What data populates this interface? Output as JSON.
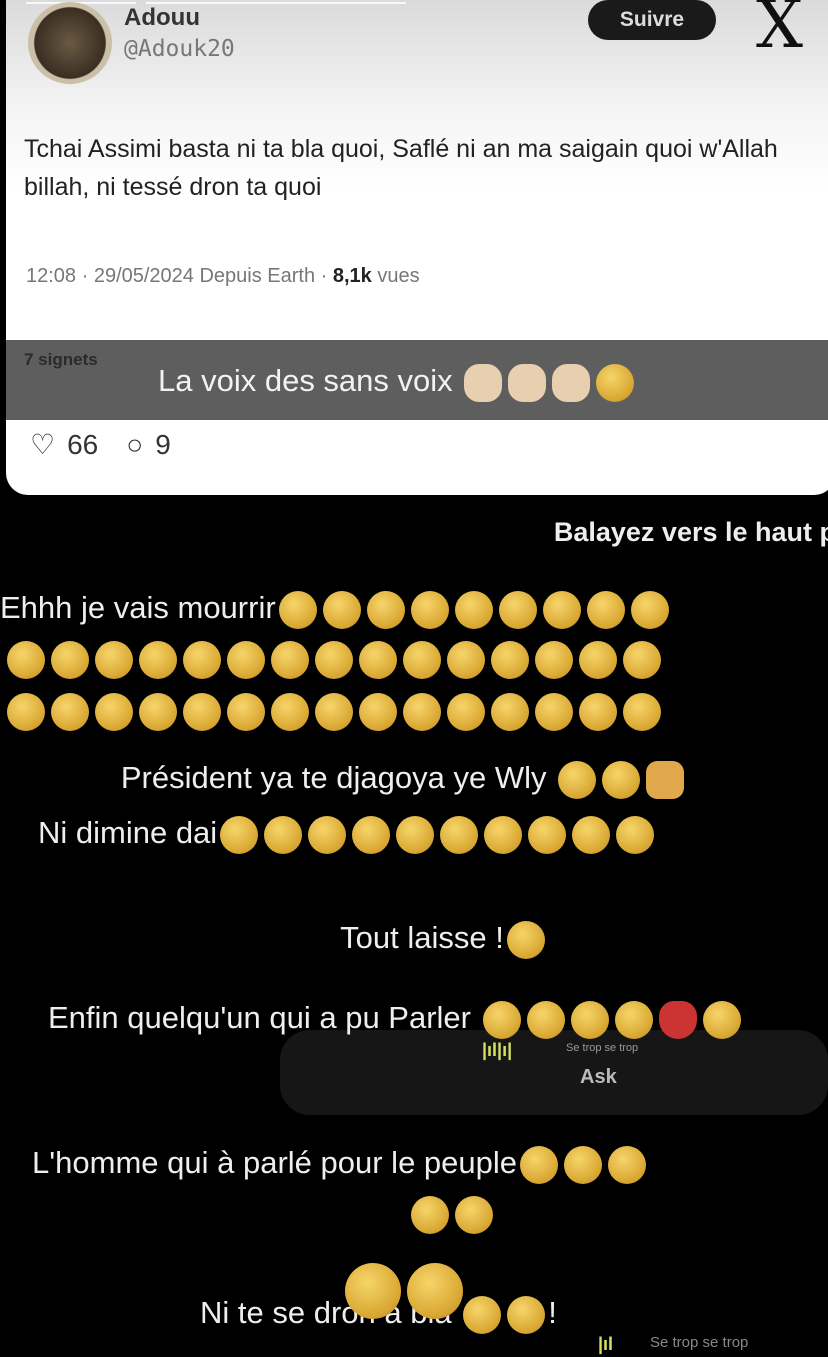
{
  "tweet": {
    "name": "Adouu",
    "handle": "@Adouk20",
    "follow_label": "Suivre",
    "logo": "X",
    "text": "Tchai Assimi basta ni ta bla quoi, Saflé ni an ma saigain quoi w'Allah billah, ni tessé dron ta quoi",
    "time": "12:08 · 29/05/2024 Depuis Earth · ",
    "views_count": "8,1k",
    "views_label": " vues",
    "bookmarks": "7 signets",
    "likes": "66",
    "replies": "9"
  },
  "story": {
    "caption": "La voix des sans voix",
    "caption_emojis": "👏👏👏🤣",
    "swipe_hint": "Balayez vers le haut p",
    "comments": [
      {
        "text": "Ehhh je vais mourrir",
        "emojis": "🤣🤣🤣🤣🤣🤣😭😭😭"
      },
      {
        "text": "",
        "emojis": "😭😭🤣😭😭😭😭😭🤣🤣🤣🤣🤣🤣🤣"
      },
      {
        "text": "",
        "emojis": "🤣🤣🤣🤣🤣🤣🤣🤣🤣🤣🤣🤣🤣😭😭"
      },
      {
        "text": "Président ya te djagoya ye Wly",
        "emojis": "😭😭🙏"
      },
      {
        "text": "Ni dimine dai",
        "emojis": "😂😂😂😂😂😂😂😂😂😂"
      },
      {
        "text": "Tout laisse !",
        "emojis": "🤣"
      },
      {
        "text": "Enfin quelqu'un qui a pu Parler",
        "emojis": "🤣🤣🤣🤣💔🤣"
      },
      {
        "text": "L'homme qui à parlé pour le peuple",
        "emojis": "🤣🤣🤣"
      },
      {
        "text": "",
        "emojis": "🤣🤣"
      },
      {
        "text": "Ni te se dron a bla",
        "emojis": "🤣🥲",
        "suffix": "!"
      }
    ],
    "sticker_emojis": "🤣😭",
    "overlay_song": "Se trop se trop",
    "overlay_artist": "Ask",
    "bottom_song": "Se trop se trop"
  }
}
